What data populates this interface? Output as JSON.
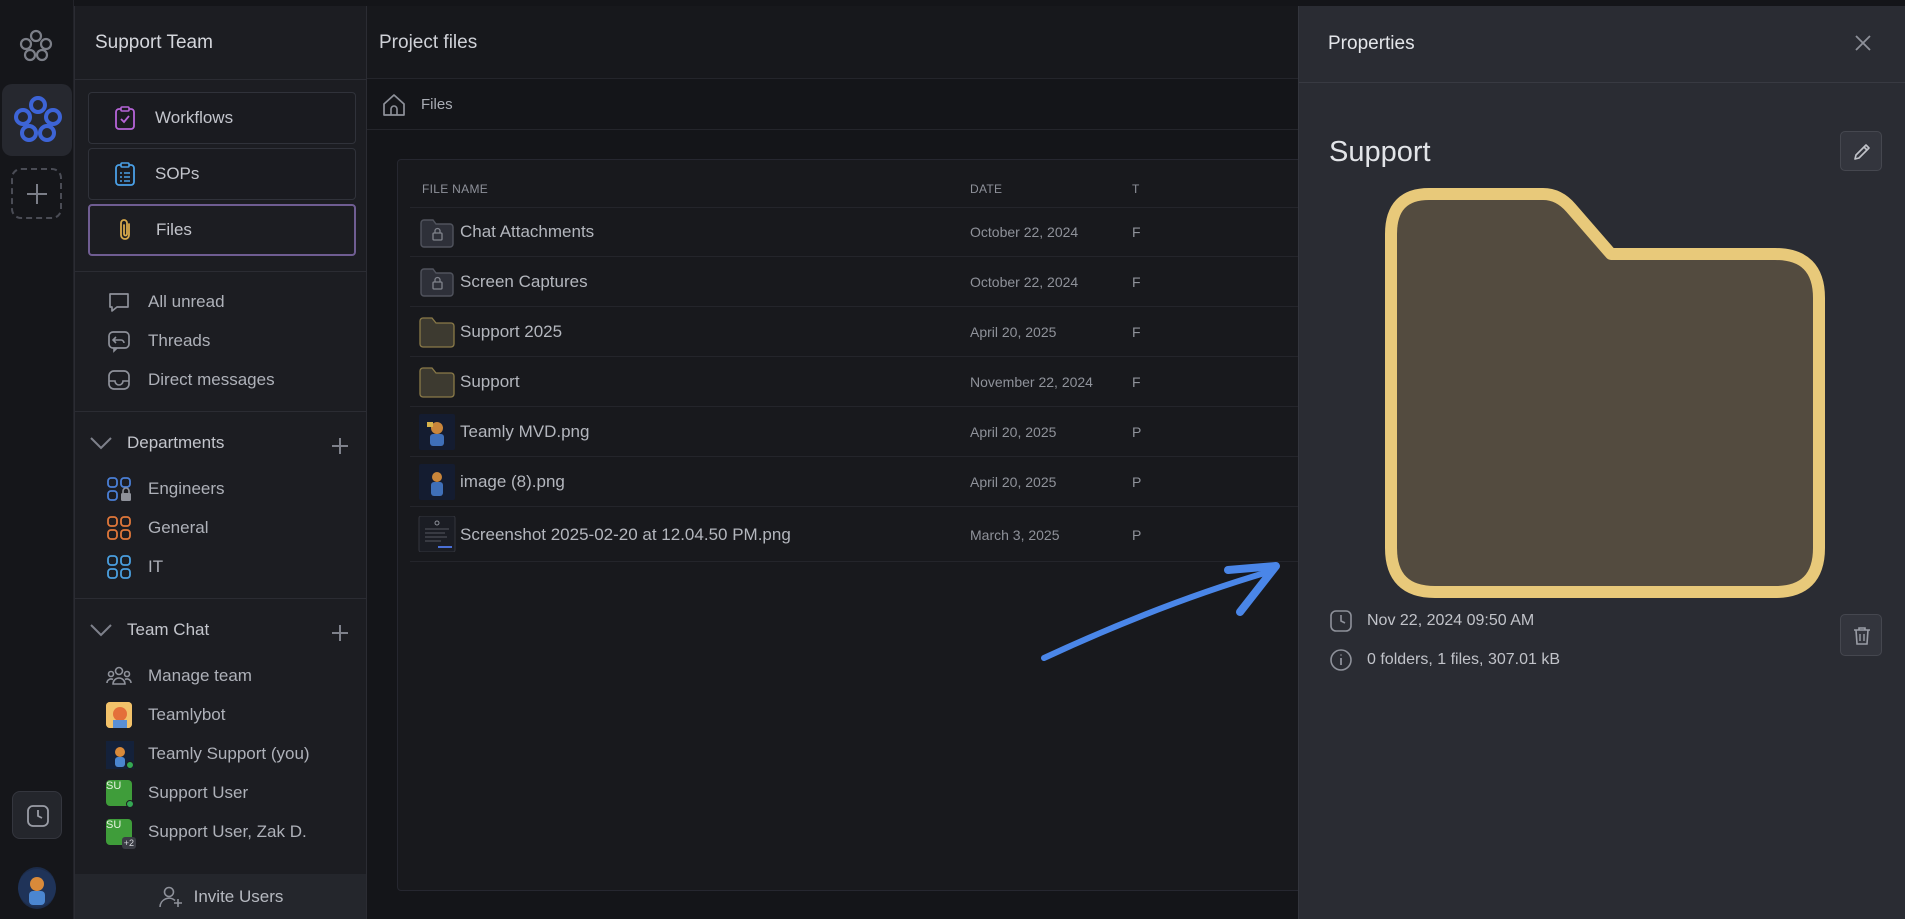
{
  "sidebar": {
    "team_title": "Support Team",
    "nav": [
      {
        "label": "Workflows",
        "icon": "clipboard-check-icon"
      },
      {
        "label": "SOPs",
        "icon": "clipboard-list-icon"
      },
      {
        "label": "Files",
        "icon": "paperclip-icon",
        "active": true
      }
    ],
    "quick": [
      {
        "label": "All unread",
        "icon": "chat-bubble-icon"
      },
      {
        "label": "Threads",
        "icon": "threads-icon"
      },
      {
        "label": "Direct messages",
        "icon": "inbox-icon"
      }
    ],
    "departments": {
      "title": "Departments",
      "items": [
        {
          "label": "Engineers",
          "icon": "grid-lock-icon",
          "color": "#4a7fd6"
        },
        {
          "label": "General",
          "icon": "grid-icon",
          "color": "#e0773a"
        },
        {
          "label": "IT",
          "icon": "grid-icon",
          "color": "#4a9fe0"
        }
      ]
    },
    "team_chat": {
      "title": "Team Chat",
      "items": [
        {
          "label": "Manage team",
          "icon": "team-icon"
        },
        {
          "label": "Teamlybot",
          "icon": "bot-avatar"
        },
        {
          "label": "Teamly Support (you)",
          "icon": "user-avatar"
        },
        {
          "label": "Support User",
          "initials": "SU",
          "color": "#3f9d3a"
        },
        {
          "label": "Support User, Zak D.",
          "initials": "SU",
          "badge": "+2",
          "color": "#3f9d3a"
        }
      ]
    },
    "invite_label": "Invite Users"
  },
  "main": {
    "title": "Project files",
    "breadcrumb": "Files",
    "columns": {
      "name": "FILE NAME",
      "date": "DATE",
      "type": "T"
    },
    "rows": [
      {
        "name": "Chat Attachments",
        "date": "October 22, 2024",
        "type": "F",
        "kind": "locked-folder"
      },
      {
        "name": "Screen Captures",
        "date": "October 22, 2024",
        "type": "F",
        "kind": "locked-folder"
      },
      {
        "name": "Support 2025",
        "date": "April 20, 2025",
        "type": "F",
        "kind": "folder"
      },
      {
        "name": "Support",
        "date": "November 22, 2024",
        "type": "F",
        "kind": "folder"
      },
      {
        "name": "Teamly MVD.png",
        "date": "April 20, 2025",
        "type": "P",
        "kind": "image"
      },
      {
        "name": "image (8).png",
        "date": "April 20, 2025",
        "type": "P",
        "kind": "image"
      },
      {
        "name": "Screenshot 2025-02-20 at 12.04.50 PM.png",
        "date": "March 3, 2025",
        "type": "P",
        "kind": "screenshot"
      }
    ]
  },
  "properties": {
    "title": "Properties",
    "name": "Support",
    "timestamp": "Nov 22, 2024 09:50 AM",
    "summary": "0 folders, 1 files, 307.01 kB",
    "folder_color": "#e8c97a"
  },
  "colors": {
    "accent_purple": "#6f5d92",
    "arrow_blue": "#4a86e8"
  }
}
